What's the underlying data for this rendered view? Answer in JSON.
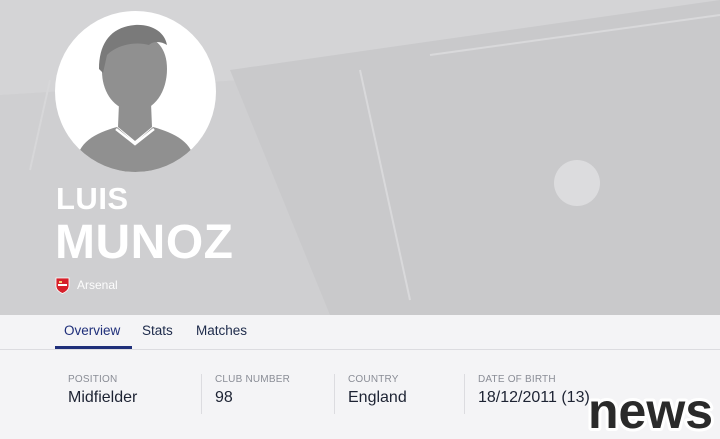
{
  "player": {
    "first_name": "LUIS",
    "last_name": "MUNOZ",
    "club": "Arsenal"
  },
  "tabs": [
    {
      "label": "Overview",
      "active": true
    },
    {
      "label": "Stats",
      "active": false
    },
    {
      "label": "Matches",
      "active": false
    }
  ],
  "info": [
    {
      "label": "POSITION",
      "value": "Midfielder"
    },
    {
      "label": "CLUB NUMBER",
      "value": "98"
    },
    {
      "label": "COUNTRY",
      "value": "England"
    },
    {
      "label": "DATE OF BIRTH",
      "value": "18/12/2011 (13)"
    }
  ],
  "watermark": {
    "text": "news"
  },
  "colors": {
    "hero_background": "#cfcfd1",
    "accent": "#1f2f7a",
    "crest_red": "#d6202b"
  },
  "icons": {
    "avatar": "person-silhouette-icon",
    "club_crest": "arsenal-crest-icon"
  }
}
